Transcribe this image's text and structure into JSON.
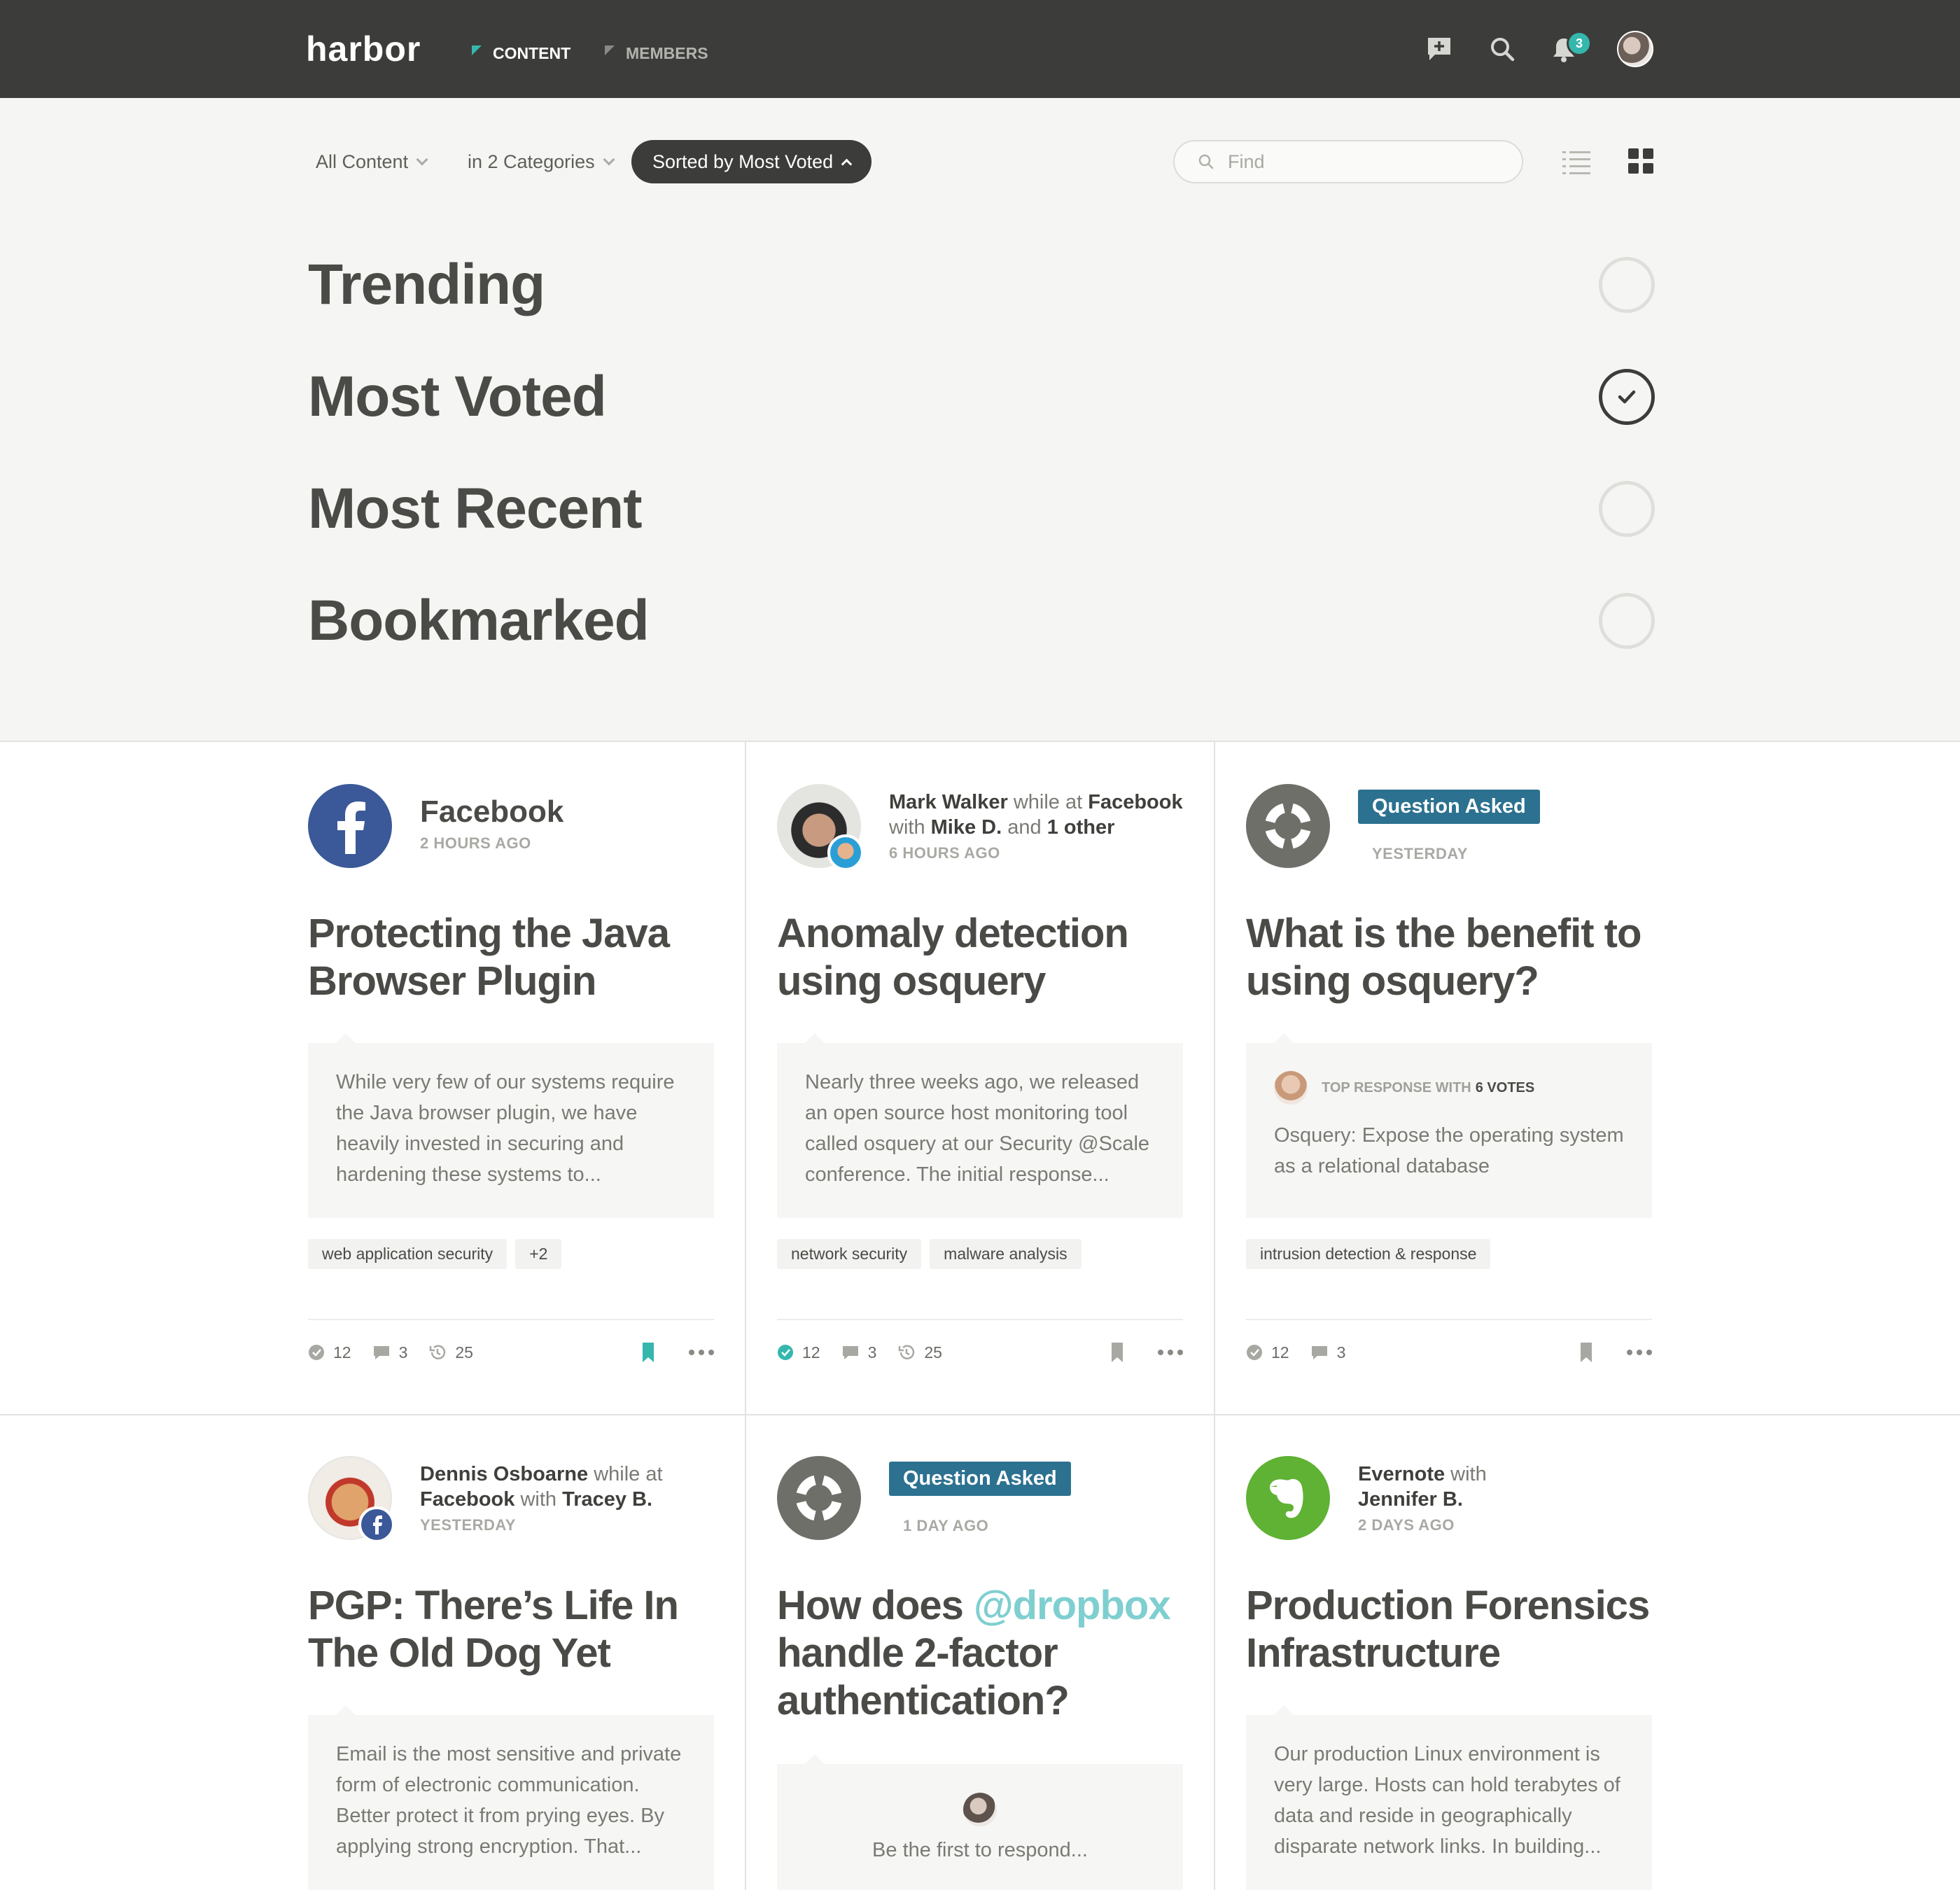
{
  "app": {
    "logo": "harbor"
  },
  "nav": {
    "content": "CONTENT",
    "members": "MEMBERS"
  },
  "notifications": {
    "count": "3"
  },
  "filters": {
    "all": "All Content",
    "categories": "in 2 Categories",
    "sort": "Sorted by Most Voted",
    "find_placeholder": "Find"
  },
  "sort_options": [
    {
      "label": "Trending",
      "checked": false
    },
    {
      "label": "Most Voted",
      "checked": true
    },
    {
      "label": "Most Recent",
      "checked": false
    },
    {
      "label": "Bookmarked",
      "checked": false
    }
  ],
  "colors": {
    "accent": "#35b7ad",
    "question_badge": "#2c7190",
    "topbar": "#3c3c3a",
    "facebook": "#3b5998",
    "evernote": "#5fb233"
  },
  "cards": [
    {
      "source": "Facebook",
      "time": "2 HOURS AGO",
      "title": "Protecting the Java Browser Plugin",
      "excerpt": "While very few of our systems require the Java browser plugin, we have heavily invested in securing and hardening these systems to...",
      "tags": [
        "web application security",
        "+2"
      ],
      "votes": "12",
      "comments": "3",
      "views": "25"
    },
    {
      "author": "Mark Walker",
      "while_at": "while at",
      "org": "Facebook",
      "with": "with",
      "coauthor": "Mike D.",
      "and": "and",
      "others": "1 other",
      "time": "6 HOURS AGO",
      "title": "Anomaly detection using osquery",
      "excerpt": "Nearly three weeks ago, we released an open source host monitoring tool called osquery at our Security @Scale conference. The initial response...",
      "tags": [
        "network security",
        "malware analysis"
      ],
      "votes": "12",
      "comments": "3",
      "views": "25"
    },
    {
      "badge": "Question Asked",
      "time": "YESTERDAY",
      "title": "What is the benefit to using osquery?",
      "top_response_prefix": "TOP RESPONSE WITH",
      "top_response_votes": "6 VOTES",
      "excerpt": "Osquery: Expose the operating system as a relational database",
      "tags": [
        "intrusion detection & response"
      ],
      "votes": "12",
      "comments": "3"
    },
    {
      "author": "Dennis Osboarne",
      "while_at": "while at",
      "org": "Facebook",
      "with": "with",
      "coauthor": "Tracey B.",
      "time": "YESTERDAY",
      "title": "PGP: There’s Life In The Old Dog Yet",
      "excerpt": "Email is the most sensitive and private form of electronic communication. Better protect it from prying eyes. By applying strong encryption. That..."
    },
    {
      "badge": "Question Asked",
      "time": "1 DAY AGO",
      "title_pre": "How does",
      "title_mention": "@dropbox",
      "title_post": "handle 2-factor authentication?",
      "respond": "Be the first to respond..."
    },
    {
      "org": "Evernote",
      "with": "with",
      "coauthor": "Jennifer B.",
      "time": "2 DAYS AGO",
      "title": "Production Forensics Infrastructure",
      "excerpt": "Our production Linux environment is very large. Hosts can hold terabytes of data and reside in geographically disparate network links. In building..."
    }
  ]
}
